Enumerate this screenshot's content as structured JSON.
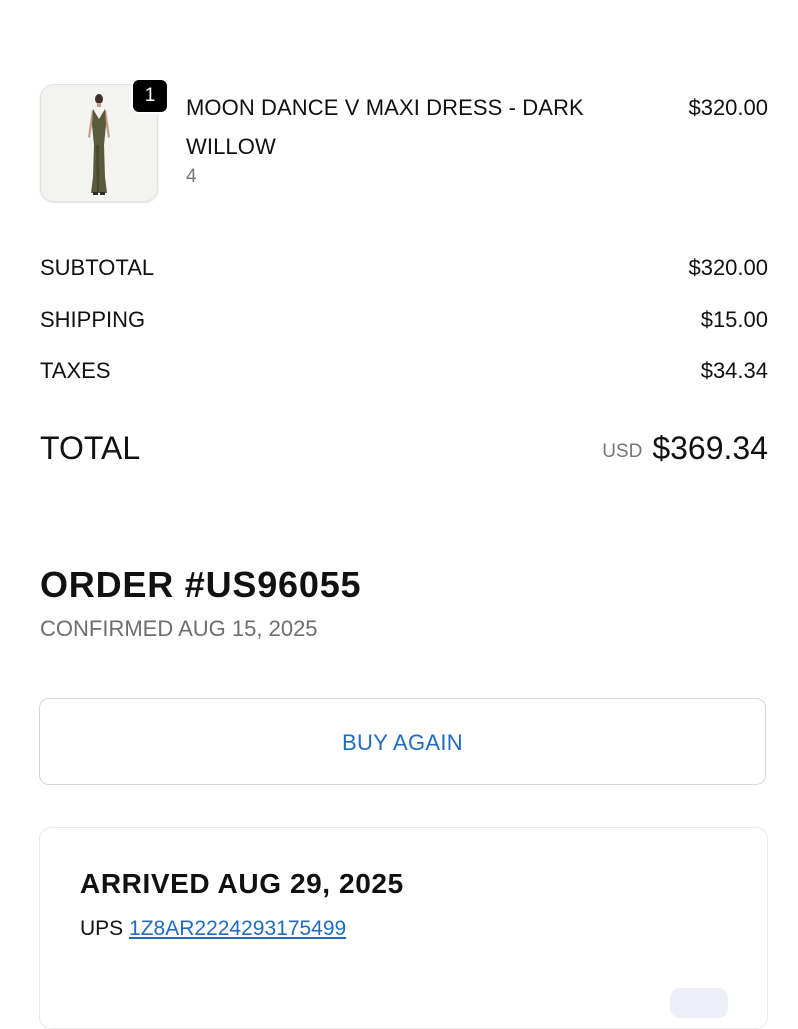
{
  "line_item": {
    "quantity_badge": "1",
    "title": "MOON DANCE V MAXI DRESS - DARK WILLOW",
    "variant": "4",
    "price": "$320.00"
  },
  "summary": {
    "subtotal_label": "SUBTOTAL",
    "subtotal_value": "$320.00",
    "shipping_label": "SHIPPING",
    "shipping_value": "$15.00",
    "taxes_label": "TAXES",
    "taxes_value": "$34.34",
    "total_label": "TOTAL",
    "total_currency": "USD",
    "total_value": "$369.34"
  },
  "order": {
    "title": "ORDER #US96055",
    "confirmed": "CONFIRMED AUG 15, 2025",
    "buy_again_label": "BUY AGAIN"
  },
  "shipment": {
    "status": "ARRIVED AUG 29, 2025",
    "carrier": "UPS",
    "tracking_number": "1Z8AR2224293175499"
  },
  "colors": {
    "link": "#1f6bc1",
    "muted_text": "#767676",
    "badge_bg": "#000000",
    "border": "#d6d6d6"
  },
  "icons": {
    "product_image": "product-thumbnail-dress"
  }
}
